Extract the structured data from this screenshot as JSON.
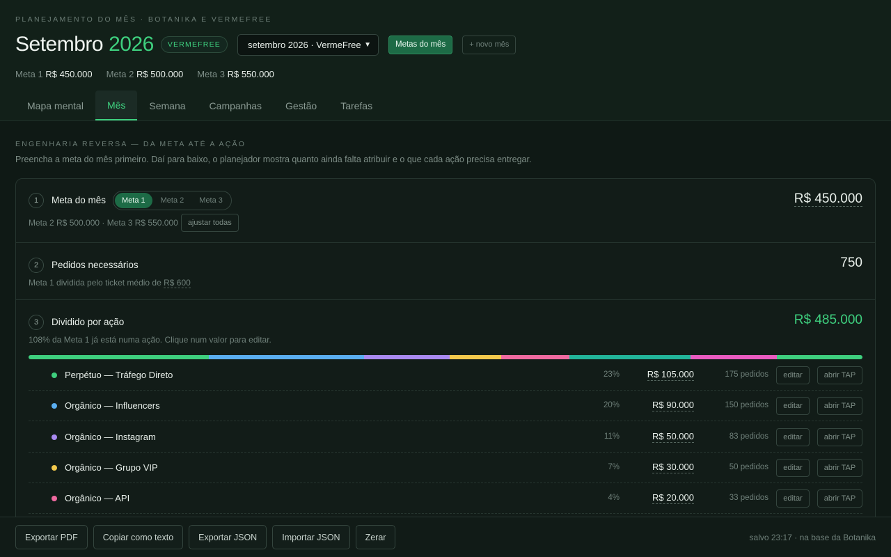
{
  "header": {
    "eyebrow": "PLANEJAMENTO DO MÊS · BOTANIKA E VERMEFREE",
    "month": "Setembro",
    "year": "2026",
    "brand_badge": "VERMEFREE",
    "month_select": "setembro 2026 · VermeFree",
    "metas_button": "Metas do mês",
    "new_month_button": "+ novo mês",
    "metas": [
      {
        "label": "Meta 1",
        "value": "R$ 450.000"
      },
      {
        "label": "Meta 2",
        "value": "R$ 500.000"
      },
      {
        "label": "Meta 3",
        "value": "R$ 550.000"
      }
    ]
  },
  "tabs": [
    "Mapa mental",
    "Mês",
    "Semana",
    "Campanhas",
    "Gestão",
    "Tarefas"
  ],
  "active_tab": "Mês",
  "section": {
    "eyebrow": "ENGENHARIA REVERSA — DA META ATÉ A AÇÃO",
    "description": "Preencha a meta do mês primeiro. Daí para baixo, o planejador mostra quanto ainda falta atribuir e o que cada ação precisa entregar."
  },
  "step1": {
    "num": "1",
    "title": "Meta do mês",
    "seg": [
      "Meta 1",
      "Meta 2",
      "Meta 3"
    ],
    "sub": "Meta 2 R$ 500.000 · Meta 3 R$ 550.000",
    "adjust_button": "ajustar todas",
    "value": "R$ 450.000"
  },
  "step2": {
    "num": "2",
    "title": "Pedidos necessários",
    "sub_prefix": "Meta 1 dividida pelo ticket médio de",
    "ticket": "R$ 600",
    "value": "750"
  },
  "step3": {
    "num": "3",
    "title": "Dividido por ação",
    "sub": "108% da Meta 1 já está numa ação. Clique num valor para editar.",
    "value": "R$ 485.000",
    "accent": "#3ecf7e"
  },
  "allocation_bar": [
    {
      "share": 0.216,
      "color": "#3ecf7e"
    },
    {
      "share": 0.186,
      "color": "#5aaef0"
    },
    {
      "share": 0.103,
      "color": "#a98af0"
    },
    {
      "share": 0.062,
      "color": "#f2c94c"
    },
    {
      "share": 0.082,
      "color": "#ef6aa0"
    },
    {
      "share": 0.145,
      "color": "#22b59a"
    },
    {
      "share": 0.103,
      "color": "#e95bc0"
    },
    {
      "share": 0.103,
      "color": "#3ecf7e"
    }
  ],
  "actions": [
    {
      "name": "Perpétuo — Tráfego Direto",
      "pct": "23%",
      "value": "R$ 105.000",
      "orders": "175 pedidos",
      "color": "#3ecf7e"
    },
    {
      "name": "Orgânico — Influencers",
      "pct": "20%",
      "value": "R$ 90.000",
      "orders": "150 pedidos",
      "color": "#5aaef0"
    },
    {
      "name": "Orgânico — Instagram",
      "pct": "11%",
      "value": "R$ 50.000",
      "orders": "83 pedidos",
      "color": "#a98af0"
    },
    {
      "name": "Orgânico — Grupo VIP",
      "pct": "7%",
      "value": "R$ 30.000",
      "orders": "50 pedidos",
      "color": "#f2c94c"
    },
    {
      "name": "Orgânico — API",
      "pct": "4%",
      "value": "R$ 20.000",
      "orders": "33 pedidos",
      "color": "#ef6aa0"
    }
  ],
  "row_buttons": {
    "edit": "editar",
    "tap": "abrir TAP"
  },
  "footer": {
    "buttons": [
      "Exportar PDF",
      "Copiar como texto",
      "Exportar JSON",
      "Importar JSON",
      "Zerar"
    ],
    "saved": "salvo 23:17 · na base da Botanika"
  }
}
